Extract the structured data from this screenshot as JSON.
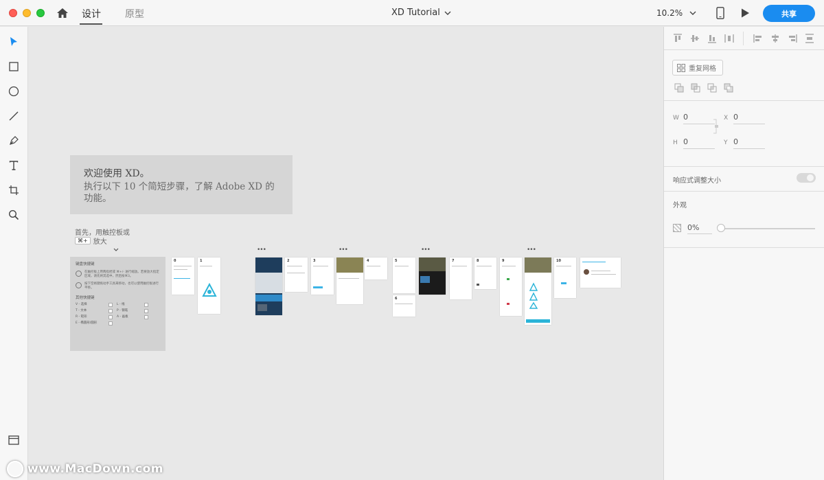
{
  "titlebar": {
    "tabs": [
      {
        "label": "设计",
        "active": true
      },
      {
        "label": "原型",
        "active": false
      }
    ],
    "document_title": "XD Tutorial",
    "zoom": "10.2%",
    "share_label": "共享",
    "icons": [
      "home-icon",
      "chevron-down-icon",
      "mobile-device-icon",
      "play-icon"
    ]
  },
  "toolbar": {
    "tools": [
      "select-icon",
      "rectangle-icon",
      "ellipse-icon",
      "line-icon",
      "pen-icon",
      "text-icon",
      "artboard-icon",
      "zoom-icon"
    ],
    "bottom": "layers-icon"
  },
  "canvas": {
    "welcome_line1": "欢迎使用 XD。",
    "welcome_line2": "执行以下 10 个简短步骤，了解 Adobe XD 的功能。",
    "hint_line1": "首先，用触控板或",
    "hint_key": "⌘+",
    "hint_zoom": "放大",
    "shortcuts_title": "键盘快捷键",
    "shortcut_tip1": "在触控板上用两指捏或 ⌘+/- 进行缩放。若要放大指定区域，请先将其选中，然后按⌘3。",
    "shortcut_tip2": "按下空格键拖动手工具来移动，也可以使用触控板进行平移。",
    "other_shortcuts_title": "其他快捷键",
    "shortcut_list": [
      {
        "key": "V - 选择",
        "key2": "L - 线"
      },
      {
        "key": "T - 文本",
        "key2": "P - 钢笔"
      },
      {
        "key": "R - 矩形",
        "key2": "A - 画板"
      },
      {
        "key": "E - 椭圆形/圆形",
        "key2": ""
      }
    ],
    "artboard_numbers": [
      "0",
      "1",
      "2",
      "3",
      "4",
      "5",
      "6",
      "7",
      "8",
      "9",
      "10"
    ],
    "more_menu": "•••"
  },
  "properties": {
    "repeat_grid_label": "重复网格",
    "w_label": "W",
    "w_value": "0",
    "h_label": "H",
    "h_value": "0",
    "x_label": "X",
    "x_value": "0",
    "y_label": "Y",
    "y_value": "0",
    "responsive_label": "响应式调整大小",
    "responsive_enabled": false,
    "appearance_label": "外观",
    "opacity_value": "0%",
    "opacity_fraction": 0.0
  },
  "watermark": {
    "text": "www.MacDown.com"
  },
  "colors": {
    "accent": "#1a8cf0",
    "canvas": "#e8e8e8",
    "panel": "#f7f7f7"
  }
}
